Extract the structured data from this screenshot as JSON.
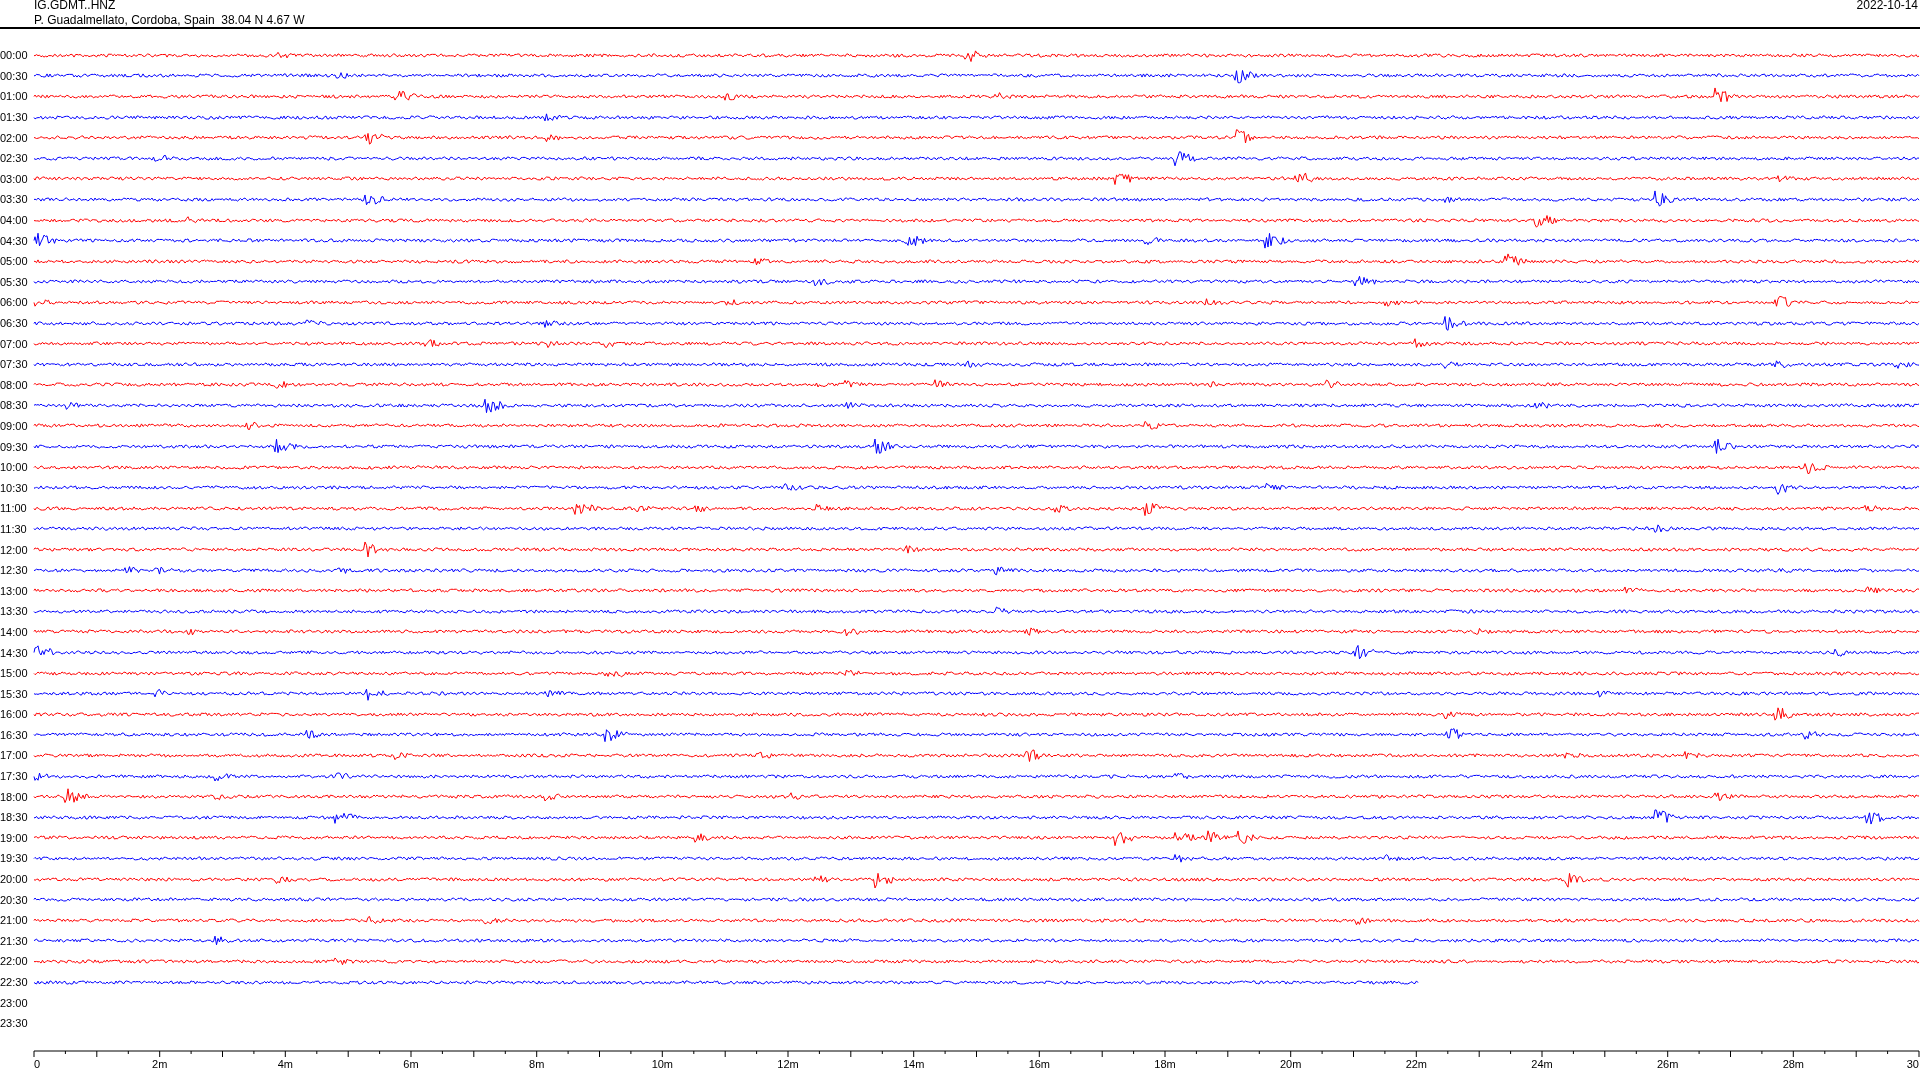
{
  "header": {
    "station": "IG.GDMT..HNZ",
    "location": "P. Guadalmellato, Cordoba, Spain  38.04 N 4.67 W",
    "date": "2022-10-14"
  },
  "rows": [
    {
      "label": "00:00",
      "trace": {
        "color": "#ff0000",
        "level": 1
      }
    },
    {
      "label": "00:30",
      "trace": {
        "color": "#0000ff",
        "level": 1
      }
    },
    {
      "label": "01:00",
      "trace": {
        "color": "#ff0000",
        "level": 1
      }
    },
    {
      "label": "01:30",
      "trace": {
        "color": "#0000ff",
        "level": 1
      }
    },
    {
      "label": "02:00",
      "trace": {
        "color": "#ff0000",
        "level": 1
      }
    },
    {
      "label": "02:30",
      "trace": {
        "color": "#0000ff",
        "level": 1
      }
    },
    {
      "label": "03:00",
      "trace": {
        "color": "#ff0000",
        "level": 1
      }
    },
    {
      "label": "03:30",
      "trace": {
        "color": "#0000ff",
        "level": 1
      }
    },
    {
      "label": "04:00",
      "trace": {
        "color": "#ff0000",
        "level": 1
      }
    },
    {
      "label": "04:30",
      "trace": {
        "color": "#0000ff",
        "level": 1
      }
    },
    {
      "label": "05:00",
      "trace": {
        "color": "#ff0000",
        "level": 1
      }
    },
    {
      "label": "05:30",
      "trace": {
        "color": "#0000ff",
        "level": 1
      }
    },
    {
      "label": "06:00",
      "trace": {
        "color": "#ff0000",
        "level": 1
      }
    },
    {
      "label": "06:30",
      "trace": {
        "color": "#0000ff",
        "level": 1
      }
    },
    {
      "label": "07:00",
      "trace": {
        "color": "#ff0000",
        "level": 1
      }
    },
    {
      "label": "07:30",
      "trace": {
        "color": "#0000ff",
        "level": 1
      }
    },
    {
      "label": "08:00",
      "trace": {
        "color": "#ff0000",
        "level": 1
      }
    },
    {
      "label": "08:30",
      "trace": {
        "color": "#0000ff",
        "level": 1
      }
    },
    {
      "label": "09:00",
      "trace": {
        "color": "#ff0000",
        "level": 1
      }
    },
    {
      "label": "09:30",
      "trace": {
        "color": "#0000ff",
        "level": 1
      }
    },
    {
      "label": "10:00",
      "trace": {
        "color": "#ff0000",
        "level": 1
      }
    },
    {
      "label": "10:30",
      "trace": {
        "color": "#0000ff",
        "level": 1
      }
    },
    {
      "label": "11:00",
      "trace": {
        "color": "#ff0000",
        "level": 1
      }
    },
    {
      "label": "11:30",
      "trace": {
        "color": "#0000ff",
        "level": 1
      }
    },
    {
      "label": "12:00",
      "trace": {
        "color": "#ff0000",
        "level": 1
      }
    },
    {
      "label": "12:30",
      "trace": {
        "color": "#0000ff",
        "level": 1
      }
    },
    {
      "label": "13:00",
      "trace": {
        "color": "#ff0000",
        "level": 1
      }
    },
    {
      "label": "13:30",
      "trace": {
        "color": "#0000ff",
        "level": 1
      }
    },
    {
      "label": "14:00",
      "trace": {
        "color": "#ff0000",
        "level": 1
      }
    },
    {
      "label": "14:30",
      "trace": {
        "color": "#0000ff",
        "level": 1
      }
    },
    {
      "label": "15:00",
      "trace": {
        "color": "#ff0000",
        "level": 1
      }
    },
    {
      "label": "15:30",
      "trace": {
        "color": "#0000ff",
        "level": 1
      }
    },
    {
      "label": "16:00",
      "trace": {
        "color": "#ff0000",
        "level": 1
      }
    },
    {
      "label": "16:30",
      "trace": {
        "color": "#0000ff",
        "level": 1
      }
    },
    {
      "label": "17:00",
      "trace": {
        "color": "#ff0000",
        "level": 1
      }
    },
    {
      "label": "17:30",
      "trace": {
        "color": "#0000ff",
        "level": 1
      }
    },
    {
      "label": "18:00",
      "trace": {
        "color": "#ff0000",
        "level": 1
      }
    },
    {
      "label": "18:30",
      "trace": {
        "color": "#0000ff",
        "level": 1
      }
    },
    {
      "label": "19:00",
      "trace": {
        "color": "#ff0000",
        "level": 1
      }
    },
    {
      "label": "19:30",
      "trace": {
        "color": "#0000ff",
        "level": 1
      }
    },
    {
      "label": "20:00",
      "trace": {
        "color": "#ff0000",
        "level": 1
      }
    },
    {
      "label": "20:30",
      "trace": {
        "color": "#0000ff",
        "level": 1
      }
    },
    {
      "label": "21:00",
      "trace": {
        "color": "#ff0000",
        "level": 1
      }
    },
    {
      "label": "21:30",
      "trace": {
        "color": "#0000ff",
        "level": 1
      }
    },
    {
      "label": "22:00",
      "trace": {
        "color": "#ff0000",
        "level": 1
      }
    },
    {
      "label": "22:30",
      "trace": {
        "color": "#0000ff",
        "level": 0.734
      }
    },
    {
      "label": "23:00"
    },
    {
      "label": "23:30"
    }
  ],
  "x_axis": {
    "labels": [
      "0",
      "2m",
      "4m",
      "6m",
      "8m",
      "10m",
      "12m",
      "14m",
      "16m",
      "18m",
      "20m",
      "22m",
      "24m",
      "26m",
      "28m",
      "30"
    ]
  }
}
